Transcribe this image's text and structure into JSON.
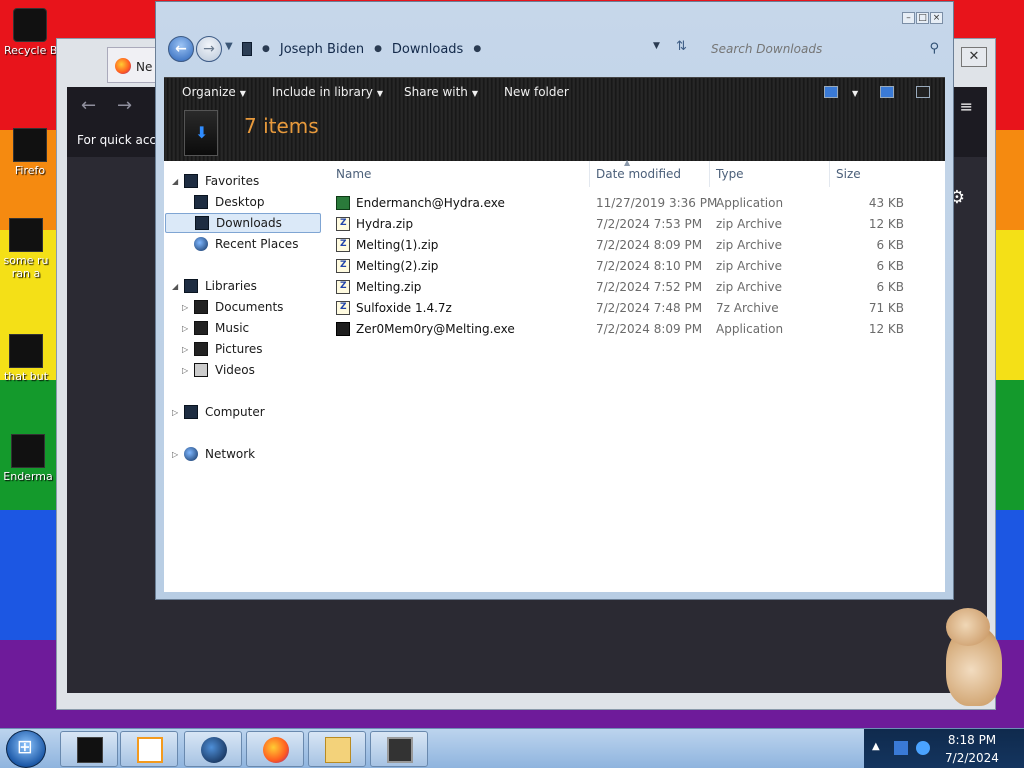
{
  "desktop": {
    "icons": [
      {
        "label": "Recycle B"
      },
      {
        "label": "Firefo"
      },
      {
        "label": "some ru"
      },
      {
        "label": "ran a"
      },
      {
        "label": "that but"
      },
      {
        "label": "Enderma"
      }
    ]
  },
  "firefox": {
    "tab_label": "Ne",
    "back_glyph": "←",
    "forward_glyph": "→",
    "quick_access_text": "For quick acces",
    "menu_glyph": "≡",
    "gear_glyph": "⚙",
    "close_glyph": "✕"
  },
  "explorer": {
    "window_controls": {
      "minimize": "–",
      "maximize": "□",
      "close": "×"
    },
    "address": {
      "crumbs": [
        "Joseph Biden",
        "Downloads"
      ],
      "search_placeholder": "Search Downloads"
    },
    "toolbar": {
      "organize": "Organize",
      "include_in_library": "Include in library",
      "share_with": "Share with",
      "new_folder": "New folder"
    },
    "items_count": "7 items",
    "nav": {
      "favorites": "Favorites",
      "desktop": "Desktop",
      "downloads": "Downloads",
      "recent_places": "Recent Places",
      "libraries": "Libraries",
      "documents": "Documents",
      "music": "Music",
      "pictures": "Pictures",
      "videos": "Videos",
      "computer": "Computer",
      "network": "Network"
    },
    "columns": {
      "name": "Name",
      "date": "Date modified",
      "type": "Type",
      "size": "Size"
    },
    "files": [
      {
        "name": "Endermanch@Hydra.exe",
        "date": "11/27/2019 3:36 PM",
        "type": "Application",
        "size": "43 KB",
        "icon": "exe-green-icon"
      },
      {
        "name": "Hydra.zip",
        "date": "7/2/2024 7:53 PM",
        "type": "zip Archive",
        "size": "12 KB",
        "icon": "zip-icon"
      },
      {
        "name": "Melting(1).zip",
        "date": "7/2/2024 8:09 PM",
        "type": "zip Archive",
        "size": "6 KB",
        "icon": "zip-icon"
      },
      {
        "name": "Melting(2).zip",
        "date": "7/2/2024 8:10 PM",
        "type": "zip Archive",
        "size": "6 KB",
        "icon": "zip-icon"
      },
      {
        "name": "Melting.zip",
        "date": "7/2/2024 7:52 PM",
        "type": "zip Archive",
        "size": "6 KB",
        "icon": "zip-icon"
      },
      {
        "name": "Sulfoxide 1.4.7z",
        "date": "7/2/2024 7:48 PM",
        "type": "7z Archive",
        "size": "71 KB",
        "icon": "zip-icon"
      },
      {
        "name": "Zer0Mem0ry@Melting.exe",
        "date": "7/2/2024 8:09 PM",
        "type": "Application",
        "size": "12 KB",
        "icon": "exe-icon"
      }
    ]
  },
  "taskbar": {
    "buttons": [
      "explorer-dark-icon",
      "media-player-icon",
      "globe-icon",
      "firefox-icon",
      "folder-icon",
      "windows-stack-icon"
    ],
    "tray_time": "8:18 PM",
    "tray_date": "7/2/2024"
  },
  "colors": {
    "items_count": "#e89a3c",
    "desktop_red": "#e8141b",
    "taskbar": "#a7c3e3"
  }
}
